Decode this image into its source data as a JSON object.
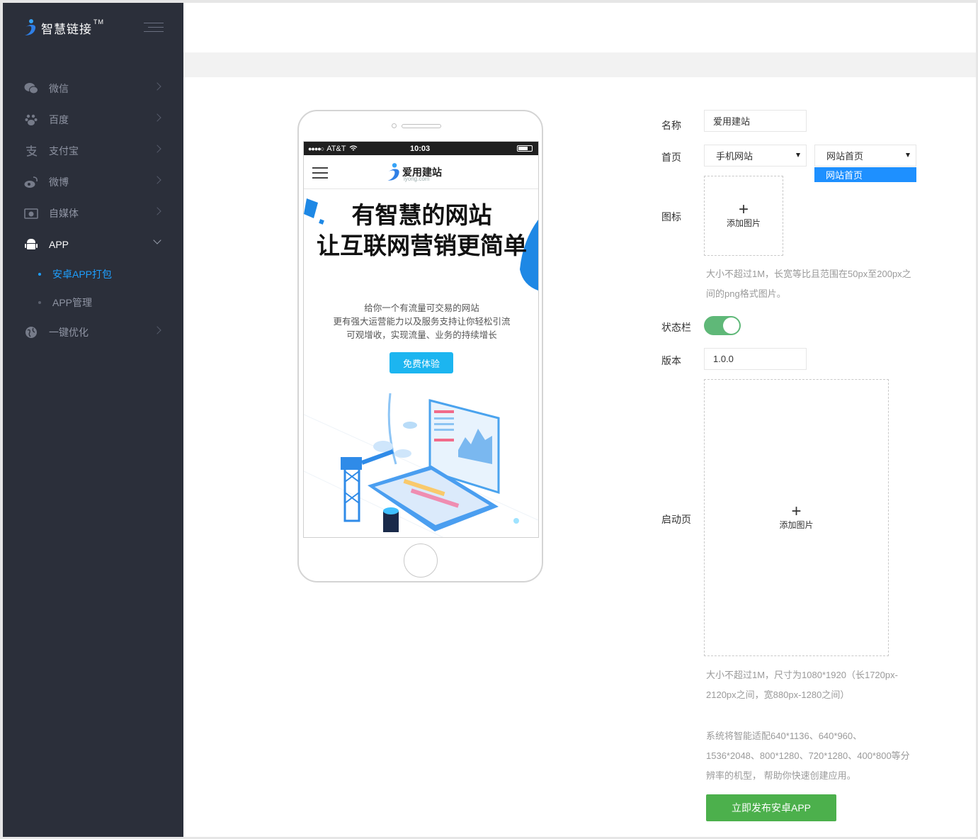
{
  "brand": {
    "name": "智慧链接",
    "tm": "TM"
  },
  "sidebar": {
    "items": [
      {
        "label": "微信",
        "icon": "wechat-icon"
      },
      {
        "label": "百度",
        "icon": "baidu-paw-icon"
      },
      {
        "label": "支付宝",
        "icon": "alipay-icon"
      },
      {
        "label": "微博",
        "icon": "weibo-icon"
      },
      {
        "label": "自媒体",
        "icon": "camera-icon"
      },
      {
        "label": "APP",
        "icon": "android-icon",
        "open": true
      },
      {
        "label": "一键优化",
        "icon": "globe-icon"
      }
    ],
    "sub_items": [
      {
        "label": "安卓APP打包",
        "active": true
      },
      {
        "label": "APP管理",
        "active": false
      }
    ]
  },
  "phone": {
    "status": {
      "carrier": "AT&T",
      "time": "10:03"
    },
    "site_name": "爱用建站",
    "site_domain": "iyong.com",
    "hero_line1": "有智慧的网站",
    "hero_line2": "让互联网营销更简单",
    "desc_line1": "给你一个有流量可交易的网站",
    "desc_line2": "更有强大运营能力以及服务支持让你轻松引流",
    "desc_line3": "可观增收，实现流量、业务的持续增长",
    "cta": "免费体验"
  },
  "form": {
    "name_label": "名称",
    "name_value": "爱用建站",
    "home_label": "首页",
    "home_select_1": "手机网站",
    "home_select_2": "网站首页",
    "home_dropdown_option": "网站首页",
    "icon_label": "图标",
    "icon_upload": "添加图片",
    "icon_hint_1": "大小不超过1M，长宽等比且范围在50px至200px之",
    "icon_hint_2": "间的png格式图片。",
    "statusbar_label": "状态栏",
    "statusbar_on": true,
    "version_label": "版本",
    "version_value": "1.0.0",
    "splash_label": "启动页",
    "splash_upload": "添加图片",
    "splash_hint_1": "大小不超过1M，尺寸为1080*1920（长1720px-",
    "splash_hint_2": "2120px之间，宽880px-1280之间）",
    "adapt_hint_1": "系统将智能适配640*1136、640*960、",
    "adapt_hint_2": "1536*2048、800*1280、720*1280、400*800等分",
    "adapt_hint_3": "辨率的机型， 帮助你快速创建应用。",
    "publish_button": "立即发布安卓APP"
  },
  "colors": {
    "sidebar_bg": "#2b2f3a",
    "active_blue": "#1e9fff",
    "switch_green": "#5fb878",
    "publish_green": "#4cb04c",
    "cta_blue": "#1cb5f0"
  }
}
